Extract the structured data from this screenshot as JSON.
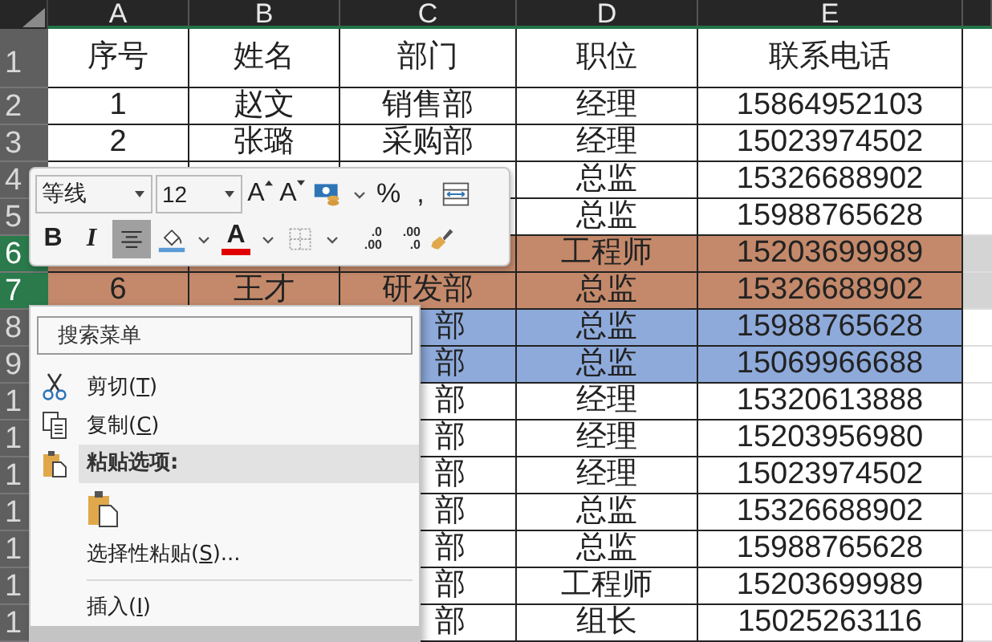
{
  "columns": [
    "A",
    "B",
    "C",
    "D",
    "E"
  ],
  "rows": [
    {
      "number": "1",
      "selected": false,
      "kind": "header",
      "cells": [
        "序号",
        "姓名",
        "部门",
        "职位",
        "联系电话"
      ]
    },
    {
      "number": "2",
      "selected": false,
      "cells": [
        "1",
        "赵文",
        "销售部",
        "经理",
        "15864952103"
      ]
    },
    {
      "number": "3",
      "selected": false,
      "cells": [
        "2",
        "张璐",
        "采购部",
        "经理",
        "15023974502"
      ]
    },
    {
      "number": "4",
      "selected": false,
      "cells": [
        null,
        null,
        null,
        "总监",
        "15326688902"
      ]
    },
    {
      "number": "5",
      "selected": false,
      "cells": [
        null,
        null,
        null,
        "总监",
        "15988765628"
      ]
    },
    {
      "number": "6",
      "selected": true,
      "color": "#c4896a",
      "cells": [
        null,
        null,
        null,
        "工程师",
        "15203699989"
      ]
    },
    {
      "number": "7",
      "selected": true,
      "color": "#c4896a",
      "cells": [
        "6",
        "王才",
        "研发部",
        "总监",
        "15326688902"
      ]
    },
    {
      "number": "8",
      "selected": false,
      "color": "#8eaadb",
      "cells": [
        null,
        null,
        "部",
        "总监",
        "15988765628"
      ]
    },
    {
      "number": "9",
      "selected": false,
      "color": "#8eaadb",
      "cells": [
        null,
        null,
        "部",
        "总监",
        "15069966688"
      ]
    },
    {
      "number": "1",
      "selected": false,
      "cells": [
        null,
        null,
        "部",
        "经理",
        "15320613888"
      ]
    },
    {
      "number": "1",
      "selected": false,
      "cells": [
        null,
        null,
        "部",
        "经理",
        "15203956980"
      ]
    },
    {
      "number": "1",
      "selected": false,
      "cells": [
        null,
        null,
        "部",
        "经理",
        "15023974502"
      ]
    },
    {
      "number": "1",
      "selected": false,
      "cells": [
        null,
        null,
        "部",
        "总监",
        "15326688902"
      ]
    },
    {
      "number": "1",
      "selected": false,
      "cells": [
        null,
        null,
        "部",
        "总监",
        "15988765628"
      ]
    },
    {
      "number": "1",
      "selected": false,
      "cells": [
        null,
        null,
        "部",
        "工程师",
        "15203699989"
      ]
    },
    {
      "number": "1",
      "selected": false,
      "cells": [
        null,
        null,
        "部",
        "组长",
        "15025263116"
      ]
    }
  ],
  "mini_toolbar": {
    "font": "等线",
    "size": "12",
    "row1": [
      {
        "kind": "grow-font",
        "label": "A"
      },
      {
        "kind": "shrink-font",
        "label": "A"
      },
      {
        "kind": "currency"
      },
      {
        "kind": "chevron"
      },
      {
        "kind": "text",
        "label": "%"
      },
      {
        "kind": "text",
        "label": ","
      },
      {
        "kind": "merge"
      }
    ],
    "row2": [
      {
        "kind": "bold",
        "label": "B",
        "selected": false
      },
      {
        "kind": "italic",
        "label": "I",
        "selected": false
      },
      {
        "kind": "align-center",
        "selected": true
      },
      {
        "kind": "fill-color"
      },
      {
        "kind": "chevron"
      },
      {
        "kind": "font-color",
        "label": "A"
      },
      {
        "kind": "chevron"
      },
      {
        "kind": "borders"
      },
      {
        "kind": "chevron"
      },
      {
        "kind": "increase-decimal",
        "top": ".0",
        "bottom": ".00"
      },
      {
        "kind": "decrease-decimal",
        "top": ".00",
        "bottom": ".0"
      },
      {
        "kind": "format-painter"
      }
    ]
  },
  "context_menu": {
    "search": {
      "placeholder": "搜索菜单"
    },
    "items": [
      {
        "kind": "cut",
        "prefix": "剪切(",
        "accel": "T",
        "suffix": ")",
        "hovered": false
      },
      {
        "kind": "copy",
        "prefix": "复制(",
        "accel": "C",
        "suffix": ")",
        "hovered": false
      },
      {
        "kind": "paste-header",
        "label": "粘贴选项:"
      },
      {
        "kind": "paste-option"
      },
      {
        "kind": "item",
        "prefix": "选择性粘贴(",
        "accel": "S",
        "suffix": ")...",
        "hovered": false
      },
      {
        "kind": "separator"
      },
      {
        "kind": "item",
        "prefix": "插入(",
        "accel": "I",
        "suffix": ")",
        "hovered": false
      },
      {
        "kind": "item",
        "hovered": true
      }
    ]
  }
}
